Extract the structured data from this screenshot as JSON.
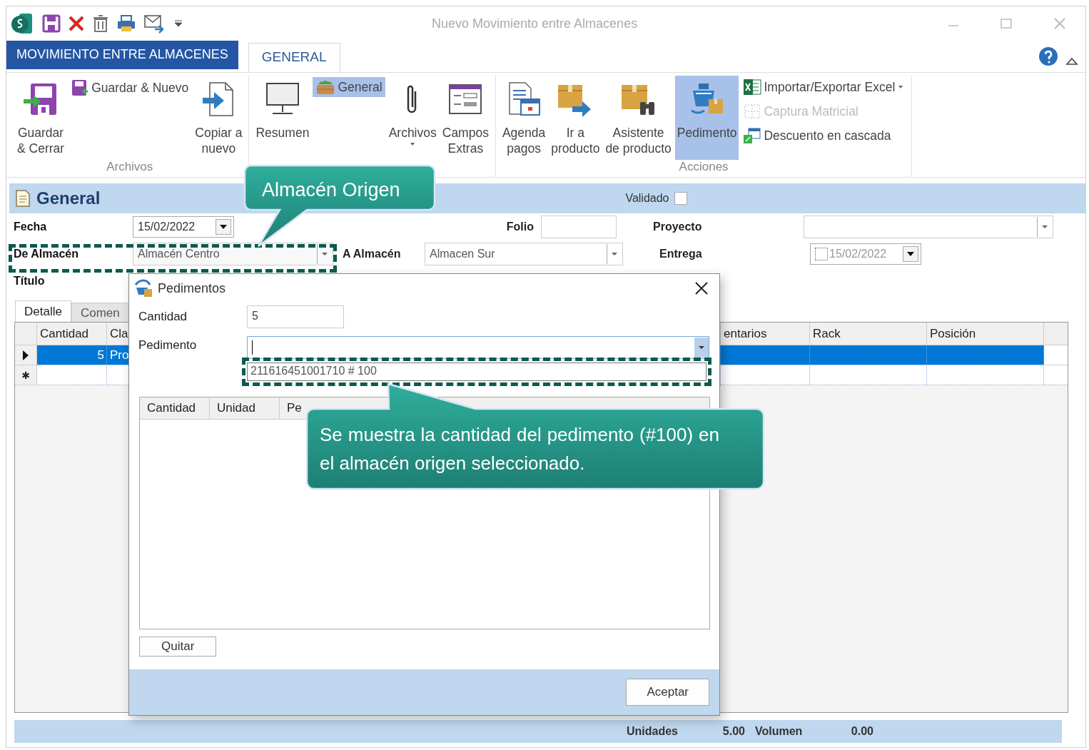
{
  "window": {
    "title": "Nuevo Movimiento entre Almacenes"
  },
  "ribbon": {
    "app_tab": "MOVIMIENTO ENTRE ALMACENES",
    "tabs": [
      {
        "label": "GENERAL",
        "selected": true
      }
    ],
    "groups": [
      {
        "label": "Archivos",
        "columns": [
          {
            "kind": "large",
            "items": [
              {
                "label": "Guardar\n& Cerrar",
                "selected": false,
                "disabled": false,
                "dropdown": false
              }
            ]
          },
          {
            "kind": "small",
            "items": [
              {
                "label": "Guardar & Nuevo",
                "selected": false,
                "disabled": false,
                "dropdown": false
              }
            ]
          },
          {
            "kind": "large",
            "items": [
              {
                "label": "Copiar a\nnuevo",
                "selected": false,
                "disabled": false,
                "dropdown": false
              }
            ]
          }
        ]
      },
      {
        "columns": [
          {
            "kind": "large",
            "items": [
              {
                "label": "Resumen",
                "selected": false,
                "disabled": false,
                "dropdown": false
              }
            ]
          },
          {
            "kind": "small",
            "items": [
              {
                "label": "General",
                "selected": true,
                "disabled": false,
                "dropdown": false
              }
            ]
          },
          {
            "kind": "large",
            "items": [
              {
                "label": "Archivos",
                "selected": false,
                "disabled": false,
                "dropdown": true
              }
            ]
          },
          {
            "kind": "large",
            "items": [
              {
                "label": "Campos\nExtras",
                "selected": false,
                "disabled": false,
                "dropdown": false
              }
            ]
          }
        ]
      },
      {
        "label": "Acciones",
        "columns": [
          {
            "kind": "large",
            "items": [
              {
                "label": "Agenda\npagos",
                "selected": false,
                "disabled": false,
                "dropdown": false
              }
            ]
          },
          {
            "kind": "large",
            "items": [
              {
                "label": "Ir a\nproducto",
                "selected": false,
                "disabled": false,
                "dropdown": false
              }
            ]
          },
          {
            "kind": "large",
            "items": [
              {
                "label": "Asistente\nde producto",
                "selected": false,
                "disabled": false,
                "dropdown": false
              }
            ]
          },
          {
            "kind": "large",
            "items": [
              {
                "label": "Pedimento",
                "selected": true,
                "disabled": false,
                "dropdown": false
              }
            ]
          },
          {
            "kind": "small",
            "items": [
              {
                "label": "Importar/Exportar Excel",
                "selected": false,
                "disabled": false,
                "dropdown": true
              },
              {
                "label": "Captura Matricial",
                "selected": false,
                "disabled": true,
                "dropdown": false
              },
              {
                "label": "Descuento en cascada",
                "selected": false,
                "disabled": false,
                "dropdown": false
              }
            ]
          }
        ]
      }
    ]
  },
  "section": {
    "title": "General",
    "validado": {
      "label": "Validado",
      "checked": false
    }
  },
  "form": {
    "fecha": {
      "label": "Fecha",
      "value": "15/02/2022"
    },
    "folio": {
      "label": "Folio"
    },
    "proyecto": {
      "label": "Proyecto"
    },
    "de_almacen": {
      "label": "De Almacén",
      "value": "Almacén Centro"
    },
    "a_almacen": {
      "label": "A Almacén",
      "value": "Almacen Sur"
    },
    "entrega": {
      "label": "Entrega",
      "value": "15/02/2022",
      "checked": false
    },
    "titulo": {
      "label": "Título"
    }
  },
  "detail_tabs": [
    {
      "label": "Detalle",
      "selected": true
    },
    {
      "label": "Comen",
      "selected": false
    }
  ],
  "grid": {
    "columns": [
      "Cantidad",
      "Cla",
      "entarios",
      "Rack",
      "Posición"
    ],
    "rows": [
      {
        "current": true,
        "selected": true,
        "cantidad": "5",
        "column_2": "Pro"
      },
      {
        "current": false,
        "selected": false,
        "marker": "✱"
      }
    ]
  },
  "footer": [
    {
      "label": "Unidades",
      "value": "5.00"
    },
    {
      "label": "Volumen",
      "value": "0.00"
    }
  ],
  "dialog": {
    "title": "Pedimentos",
    "cantidad": {
      "label": "Cantidad",
      "value": "5"
    },
    "pedimento": {
      "label": "Pedimento",
      "options": [
        {
          "label": "211616451001710 # 100",
          "selected": false
        }
      ]
    },
    "grid": {
      "columns": [
        "Cantidad",
        "Unidad",
        "Pe"
      ]
    },
    "quitar": "Quitar",
    "aceptar": "Aceptar"
  },
  "callouts": [
    {
      "text": "Almacén Origen"
    },
    {
      "text": "Se muestra la cantidad del pedimento (#100) en el almacén origen seleccionado."
    }
  ]
}
